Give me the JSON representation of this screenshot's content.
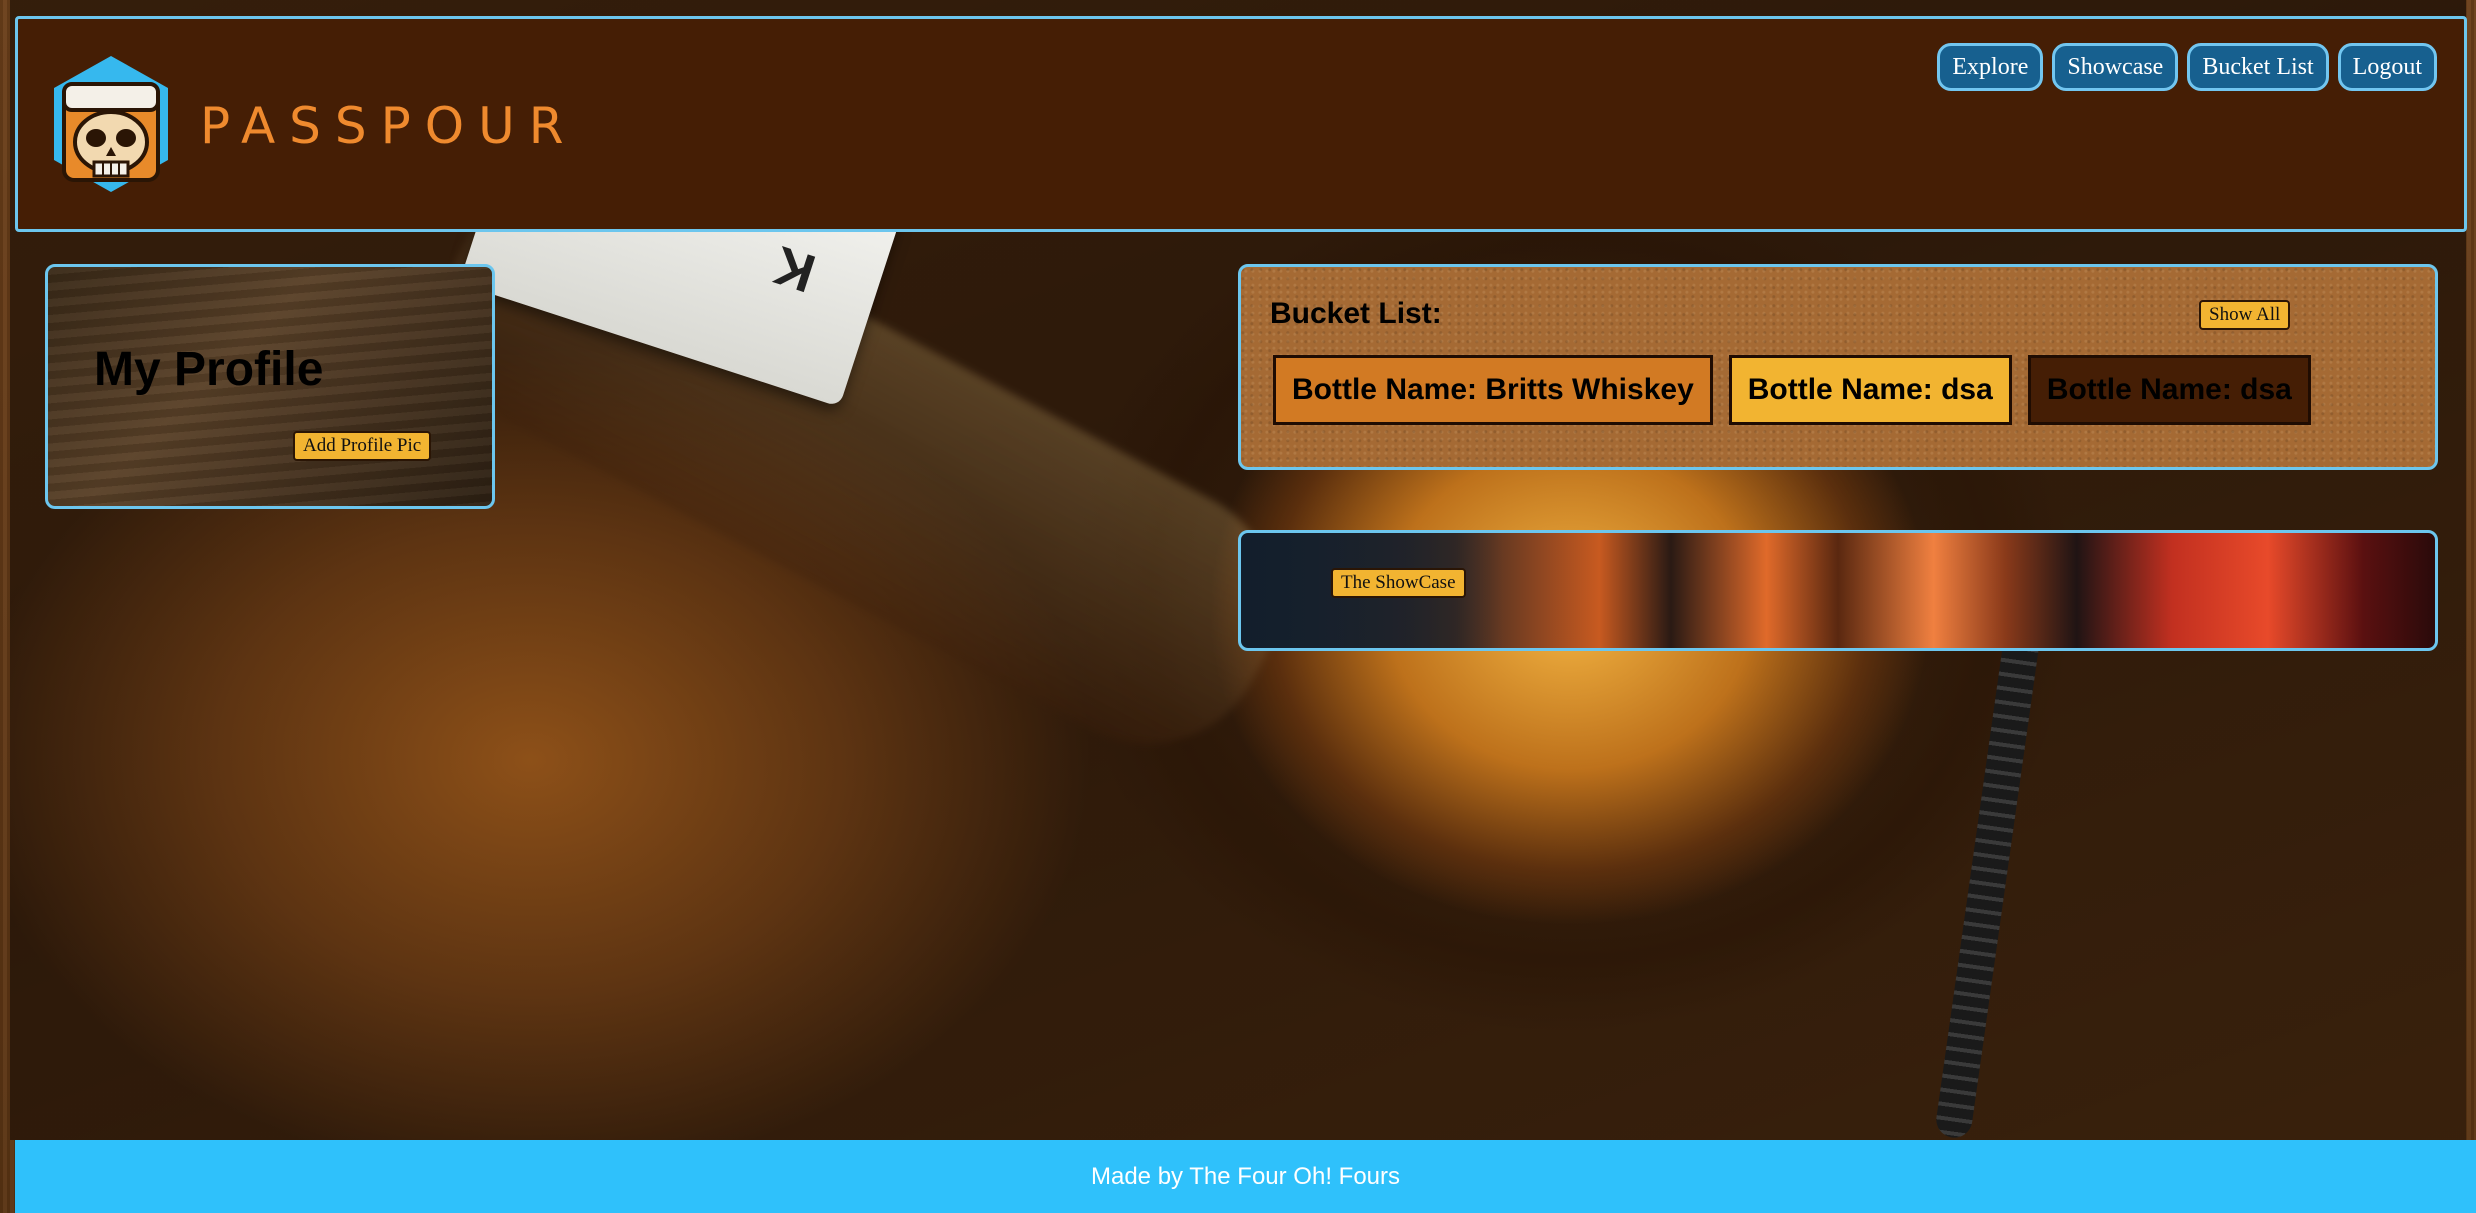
{
  "brand": {
    "name": "PASSPOUR",
    "logo_icon": "skull-whiskey-glass-icon"
  },
  "nav": {
    "items": [
      {
        "label": "Explore"
      },
      {
        "label": "Showcase"
      },
      {
        "label": "Bucket List"
      },
      {
        "label": "Logout"
      }
    ]
  },
  "profile": {
    "title": "My Profile",
    "add_pic_label": "Add Profile Pic"
  },
  "bucket_list": {
    "title": "Bucket List:",
    "show_all_label": "Show All",
    "bottles": [
      {
        "label": "Bottle Name: Britts Whiskey",
        "color": "#d27a23"
      },
      {
        "label": "Bottle Name: dsa",
        "color": "#f2b431"
      },
      {
        "label": "Bottle Name: dsa",
        "color": "#451e05"
      }
    ]
  },
  "showcase": {
    "button_label": "The ShowCase"
  },
  "footer": {
    "text": "Made by The Four Oh! Fours"
  },
  "colors": {
    "header_bg": "#451e05",
    "accent_border": "#6cc6ee",
    "nav_button_bg": "#17608f",
    "small_button_bg": "#f2b431",
    "logo_text": "#ef8a2e",
    "footer_bg": "#2fc1fb"
  }
}
